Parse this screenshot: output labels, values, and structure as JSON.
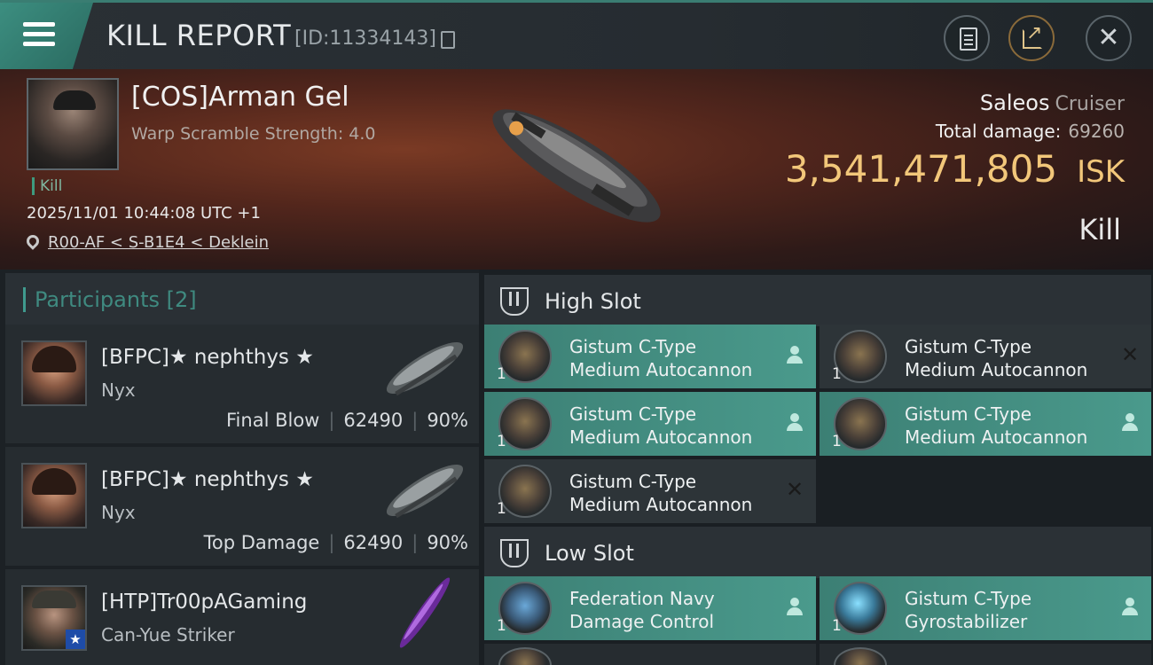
{
  "header": {
    "title": "KILL REPORT",
    "report_id": "[ID:11334143]",
    "buttons": [
      "clipboard-icon",
      "share-icon",
      "close-icon"
    ]
  },
  "victim": {
    "name": "[COS]Arman Gel",
    "subtitle": "Warp Scramble Strength: 4.0",
    "kill_tag": "Kill",
    "datetime": "2025/11/01 10:44:08 UTC +1",
    "location": "R00-AF < S-B1E4 < Deklein",
    "ship_name": "Saleos",
    "ship_class": "Cruiser",
    "total_damage_label": "Total damage:",
    "total_damage_value": "69260",
    "isk_value": "3,541,471,805",
    "isk_unit": "ISK",
    "result": "Kill"
  },
  "participants": {
    "label": "Participants",
    "count": "[2]",
    "rows": [
      {
        "name": "[BFPC]★ nephthys ★",
        "ship": "Nyx",
        "role": "Final Blow",
        "damage": "62490",
        "percent": "90%"
      },
      {
        "name": "[BFPC]★ nephthys ★",
        "ship": "Nyx",
        "role": "Top Damage",
        "damage": "62490",
        "percent": "90%"
      },
      {
        "name": "[HTP]Tr00pAGaming",
        "ship": "Can-Yue Striker"
      }
    ]
  },
  "slots": {
    "high": {
      "title": "High Slot",
      "modules": [
        {
          "line1": "Gistum C-Type",
          "line2": "Medium Autocannon",
          "qty": "1",
          "fitted": true,
          "status": "person-icon"
        },
        {
          "line1": "Gistum C-Type",
          "line2": "Medium Autocannon",
          "qty": "1",
          "fitted": false,
          "status": "x-icon"
        },
        {
          "line1": "Gistum C-Type",
          "line2": "Medium Autocannon",
          "qty": "1",
          "fitted": true,
          "status": "person-icon"
        },
        {
          "line1": "Gistum C-Type",
          "line2": "Medium Autocannon",
          "qty": "1",
          "fitted": true,
          "status": "person-icon"
        },
        {
          "line1": "Gistum C-Type",
          "line2": "Medium Autocannon",
          "qty": "1",
          "fitted": false,
          "status": "x-icon"
        }
      ]
    },
    "low": {
      "title": "Low Slot",
      "modules": [
        {
          "line1": "Federation Navy",
          "line2": "Damage Control",
          "qty": "1",
          "fitted": true,
          "status": "person-icon"
        },
        {
          "line1": "Gistum C-Type",
          "line2": "Gyrostabilizer",
          "qty": "1",
          "fitted": true,
          "status": "person-icon"
        }
      ]
    }
  },
  "colors": {
    "accent": "#3f9a8e",
    "isk": "#f2c77a",
    "fitted_module": "#4a9a8c"
  }
}
